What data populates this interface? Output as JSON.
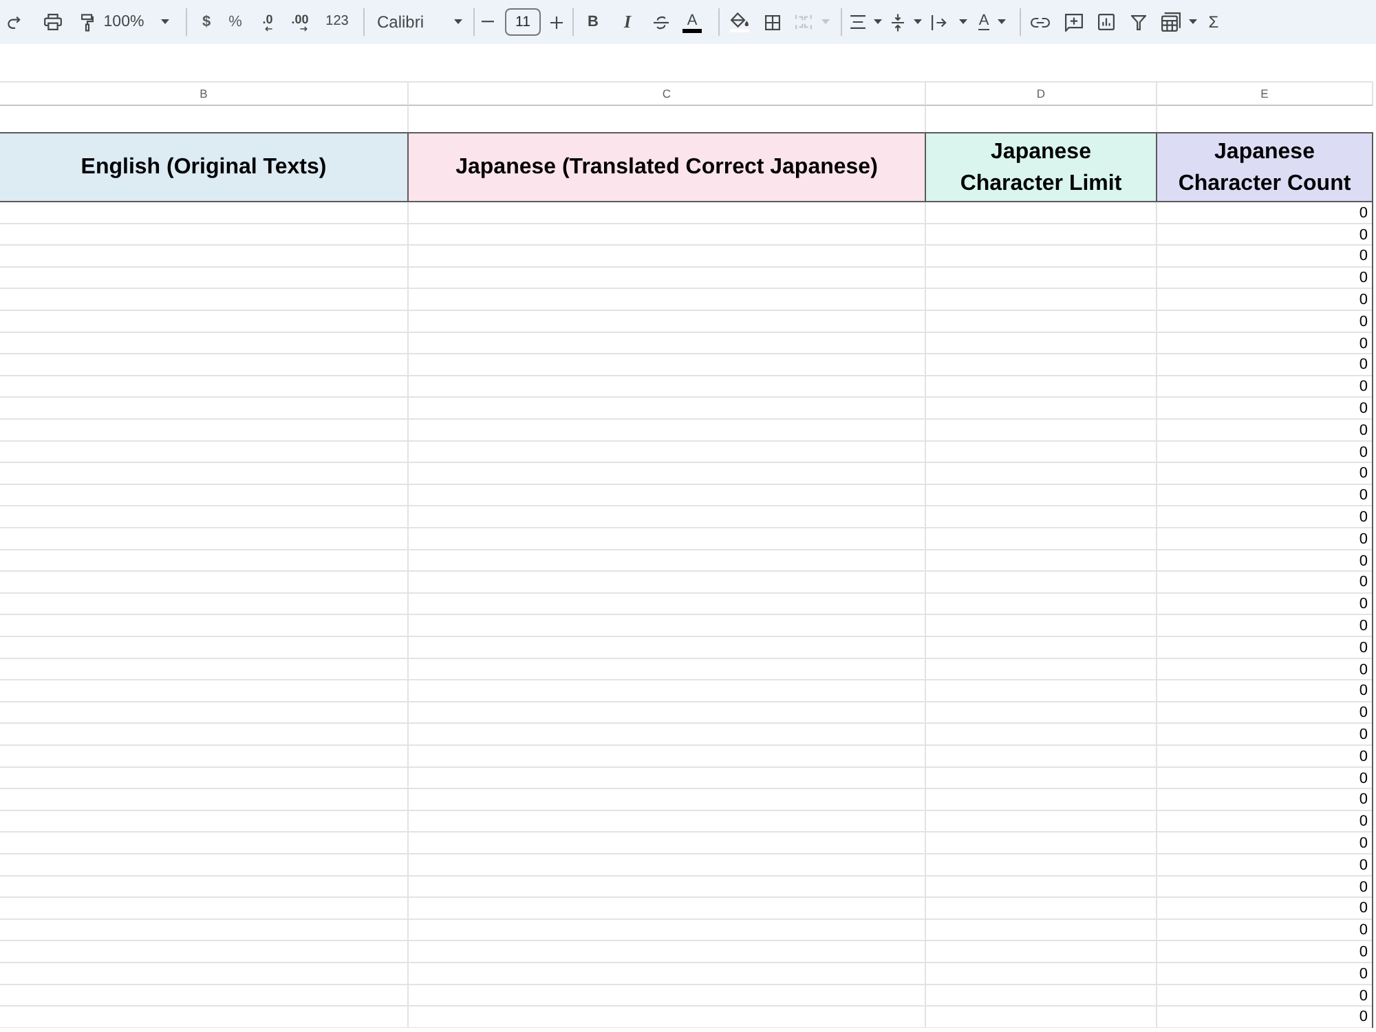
{
  "toolbar": {
    "zoom": "100%",
    "currency": "$",
    "percent": "%",
    "decrease_decimals": ".0",
    "increase_decimals": ".00",
    "more_formats": "123",
    "font": "Calibri",
    "font_size": "11",
    "bold": "B",
    "italic": "I",
    "text_color": "A",
    "merge_cells": {
      "disabled": true
    },
    "text_rotation": "A",
    "functions": "Σ"
  },
  "sheet": {
    "columns": [
      "B",
      "C",
      "D",
      "E"
    ],
    "header_cells": [
      {
        "text": "English (Original Texts)",
        "color": "#ddebf3"
      },
      {
        "text": "Japanese (Translated Correct Japanese)",
        "color": "#fbe4ec"
      },
      {
        "text": "Japanese Character Limit",
        "color": "#d9f5ed"
      },
      {
        "text": "Japanese Character Count",
        "color": "#dcdcf5"
      }
    ],
    "rows": [
      {
        "character_count": "0"
      },
      {
        "character_count": "0"
      },
      {
        "character_count": "0"
      },
      {
        "character_count": "0"
      },
      {
        "character_count": "0"
      },
      {
        "character_count": "0"
      },
      {
        "character_count": "0"
      },
      {
        "character_count": "0"
      },
      {
        "character_count": "0"
      },
      {
        "character_count": "0"
      },
      {
        "character_count": "0"
      },
      {
        "character_count": "0"
      },
      {
        "character_count": "0"
      },
      {
        "character_count": "0"
      },
      {
        "character_count": "0"
      },
      {
        "character_count": "0"
      },
      {
        "character_count": "0"
      },
      {
        "character_count": "0"
      },
      {
        "character_count": "0"
      },
      {
        "character_count": "0"
      },
      {
        "character_count": "0"
      },
      {
        "character_count": "0"
      },
      {
        "character_count": "0"
      },
      {
        "character_count": "0"
      },
      {
        "character_count": "0"
      },
      {
        "character_count": "0"
      },
      {
        "character_count": "0"
      },
      {
        "character_count": "0"
      },
      {
        "character_count": "0"
      },
      {
        "character_count": "0"
      },
      {
        "character_count": "0"
      },
      {
        "character_count": "0"
      },
      {
        "character_count": "0"
      },
      {
        "character_count": "0"
      },
      {
        "character_count": "0"
      },
      {
        "character_count": "0"
      },
      {
        "character_count": "0"
      },
      {
        "character_count": "0"
      }
    ]
  }
}
